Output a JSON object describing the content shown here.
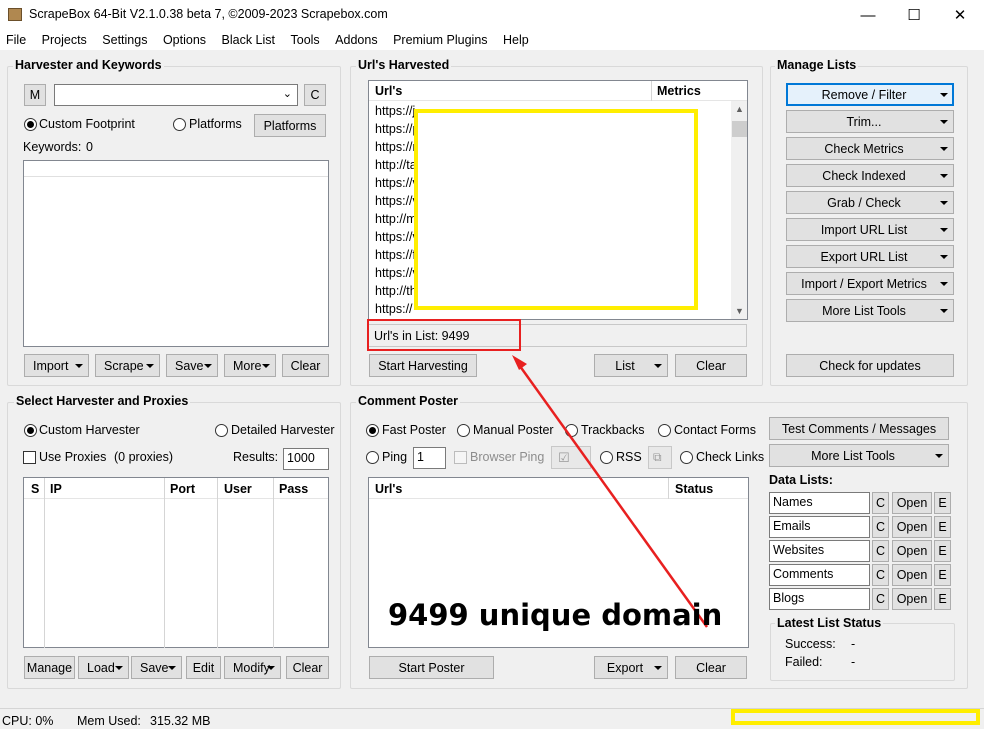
{
  "window": {
    "title": "ScrapeBox 64-Bit V2.1.0.38 beta 7, ©2009-2023 Scrapebox.com",
    "minimize": "—",
    "maximize": "☐",
    "close": "✕"
  },
  "menu": [
    "File",
    "Projects",
    "Settings",
    "Options",
    "Black List",
    "Tools",
    "Addons",
    "Premium Plugins",
    "Help"
  ],
  "harvester": {
    "title": "Harvester and Keywords",
    "m_button": "M",
    "c_button": "C",
    "footprint_value": "",
    "custom_footprint": "Custom Footprint",
    "platforms_radio": "Platforms",
    "platforms_button": "Platforms",
    "keywords_label": "Keywords:",
    "keywords_count": "0",
    "buttons": {
      "import": "Import",
      "scrape": "Scrape",
      "save": "Save",
      "more": "More",
      "clear": "Clear"
    }
  },
  "urls": {
    "title": "Url's Harvested",
    "col_url": "Url's",
    "col_metrics": "Metrics",
    "rows": [
      "https://j",
      "https://p",
      "https://r",
      "http://ta",
      "https://v",
      "https://v",
      "http://m",
      "https://v",
      "https://f",
      "https://v",
      "http://th",
      "https://"
    ],
    "count_label": "Url's in List: 9499",
    "start_button": "Start Harvesting",
    "list_button": "List",
    "clear_button": "Clear"
  },
  "manage": {
    "title": "Manage Lists",
    "buttons": [
      "Remove / Filter",
      "Trim...",
      "Check Metrics",
      "Check Indexed",
      "Grab / Check",
      "Import URL List",
      "Export URL List",
      "Import / Export Metrics",
      "More List Tools"
    ],
    "update_button": "Check for updates"
  },
  "select_harvester": {
    "title": "Select Harvester and Proxies",
    "custom_harvester": "Custom Harvester",
    "detailed_harvester": "Detailed Harvester",
    "use_proxies": "Use Proxies",
    "proxies_count": "(0 proxies)",
    "results_label": "Results:",
    "results_value": "1000",
    "columns": [
      "S",
      "IP",
      "Port",
      "User",
      "Pass"
    ],
    "buttons": {
      "manage": "Manage",
      "load": "Load",
      "save": "Save",
      "edit": "Edit",
      "modify": "Modify",
      "clear": "Clear"
    }
  },
  "comment_poster": {
    "title": "Comment Poster",
    "modes": [
      "Fast Poster",
      "Manual Poster",
      "Trackbacks",
      "Contact Forms"
    ],
    "ping": "Ping",
    "ping_value": "1",
    "browser_ping": "Browser Ping",
    "rss": "RSS",
    "check_links": "Check Links",
    "col_url": "Url's",
    "col_status": "Status",
    "start_button": "Start Poster",
    "export_button": "Export",
    "clear_button": "Clear",
    "test_button": "Test Comments / Messages",
    "more_tools_button": "More List Tools"
  },
  "data_lists": {
    "title": "Data Lists:",
    "items": [
      "Names",
      "Emails",
      "Websites",
      "Comments",
      "Blogs"
    ],
    "c": "C",
    "open": "Open",
    "e": "E"
  },
  "latest_status": {
    "title": "Latest List Status",
    "success_label": "Success:",
    "success_value": "-",
    "failed_label": "Failed:",
    "failed_value": "-"
  },
  "statusbar": {
    "cpu": "CPU:  0%",
    "mem_label": "Mem Used:",
    "mem_value": "315.32 MB"
  },
  "annotation": {
    "caption": "9499 unique domain",
    "highlight_color": "#ffee00",
    "arrow_color": "#e82020"
  }
}
